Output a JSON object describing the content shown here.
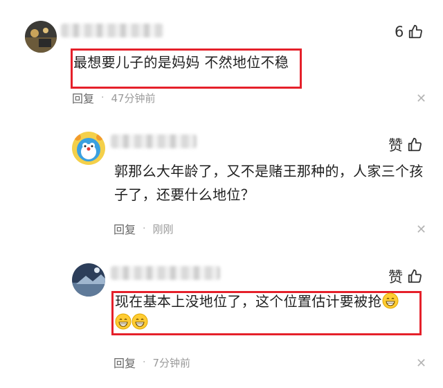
{
  "comments": [
    {
      "text": "最想要儿子的是妈妈 不然地位不稳",
      "likes": "6",
      "reply_label": "回复",
      "time": "47分钟前"
    },
    {
      "text": "郭那么大年龄了，又不是赌王那种的，人家三个孩子了，还要什么地位？",
      "likes": "赞",
      "reply_label": "回复",
      "time": "刚刚"
    },
    {
      "text": "现在基本上没地位了，这个位置估计要被抢",
      "likes": "赞",
      "reply_label": "回复",
      "time": "7分钟前"
    }
  ],
  "meta_separator": "·",
  "close_glyph": "✕",
  "icons": {
    "like": "thumbs-up-icon",
    "emoji": "grinning-face-emoji"
  },
  "colors": {
    "highlight_border": "#e5202a",
    "time_text": "#9a9a9a"
  }
}
